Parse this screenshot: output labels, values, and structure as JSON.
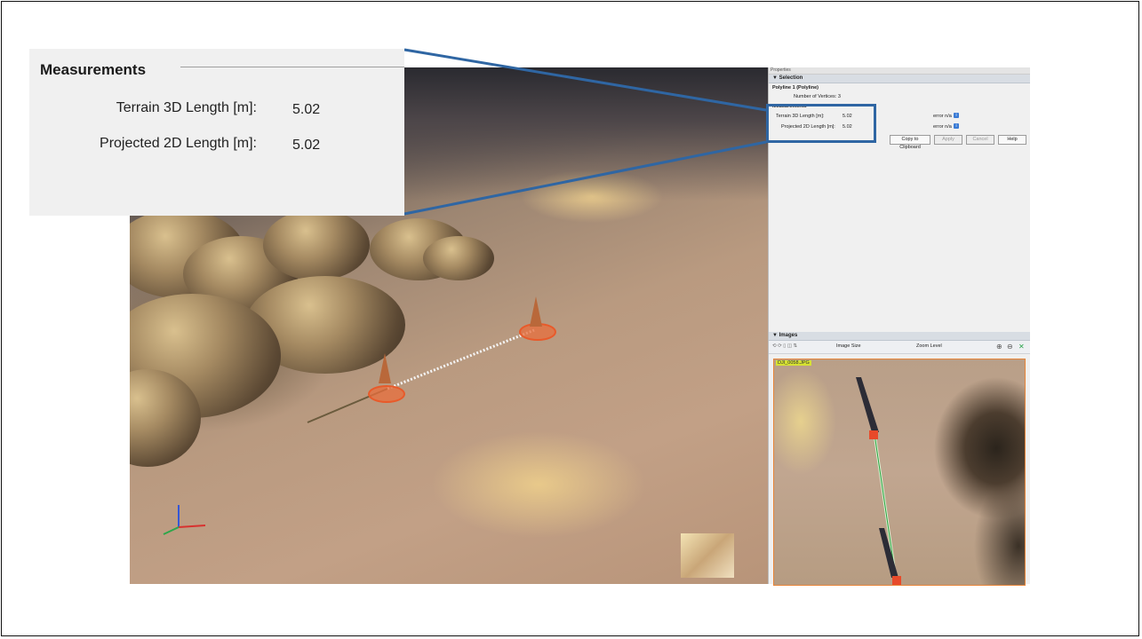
{
  "callout": {
    "heading": "Measurements",
    "rows": [
      {
        "label": "Terrain 3D Length [m]:",
        "value": "5.02"
      },
      {
        "label": "Projected 2D Length [m]:",
        "value": "5.02"
      }
    ]
  },
  "panel": {
    "title": "Properties",
    "selection_header": "Selection",
    "polyline_name": "Polyline 1 (Polyline)",
    "vertices_label": "Number of Vertices: 3",
    "measurements_header": "Measurements",
    "rows": [
      {
        "label": "Terrain 3D Length [m]:",
        "value": "5.02",
        "error": "error n/a"
      },
      {
        "label": "Projected 2D Length [m]:",
        "value": "5.02",
        "error": "error n/a"
      }
    ],
    "buttons": {
      "copy": "Copy to Clipboard",
      "apply": "Apply",
      "cancel": "Cancel",
      "help": "Help"
    },
    "images_header": "Images",
    "toolbar": {
      "image_size_label": "Image Size",
      "zoom_level_label": "Zoom Level"
    },
    "image_name": "DJI_0058.JPG"
  },
  "colors": {
    "callout_line": "#2f66a3",
    "marker": "#e85a2a",
    "section_header": "#d8dde3"
  }
}
